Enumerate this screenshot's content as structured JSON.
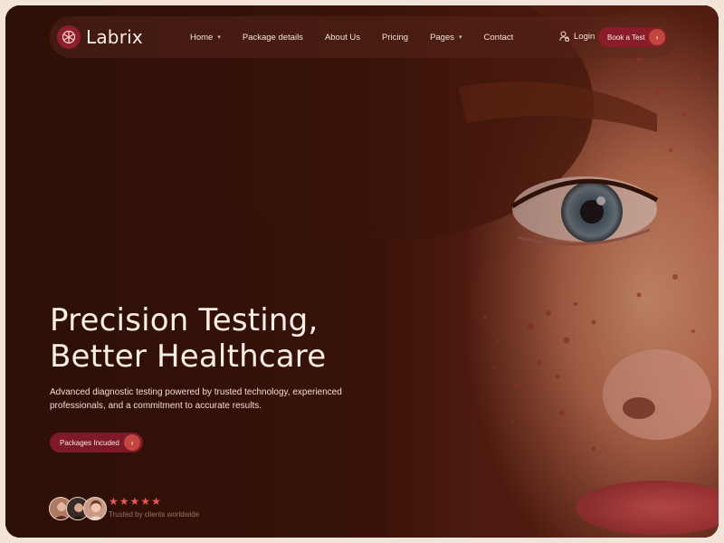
{
  "brand": {
    "name": "Labrix"
  },
  "nav": {
    "items": [
      {
        "label": "Home",
        "has_dropdown": true
      },
      {
        "label": "Package details",
        "has_dropdown": false
      },
      {
        "label": "About Us",
        "has_dropdown": false
      },
      {
        "label": "Pricing",
        "has_dropdown": false
      },
      {
        "label": "Pages",
        "has_dropdown": true
      },
      {
        "label": "Contact",
        "has_dropdown": false
      }
    ],
    "login_label": "Login",
    "login_icon": "lock-user-icon",
    "cta_label": "Book a Test",
    "cta_icon": "arrow-right-icon"
  },
  "hero": {
    "title_line1": "Precision Testing,",
    "title_line2": "Better Healthcare",
    "description": "Advanced diagnostic testing powered by trusted technology, experienced professionals, and a commitment to accurate results.",
    "button_label": "Packages Incuded",
    "button_icon": "arrow-right-icon"
  },
  "trust": {
    "rating_stars": 5,
    "text": "Trusted by clients worldwide",
    "avatar_count": 3
  },
  "colors": {
    "accent": "#8a1c2a",
    "accent_light": "#c2453f",
    "star": "#e45a55",
    "text_light": "#fbeee6",
    "background": "#2a0f08"
  }
}
